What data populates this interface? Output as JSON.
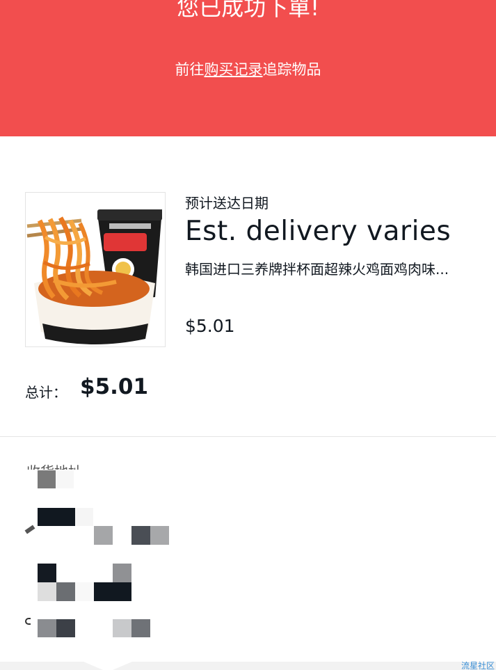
{
  "banner": {
    "title": "您已成功下單!",
    "subtitle_prefix": "前往",
    "subtitle_link": "购买记录",
    "subtitle_suffix": "追踪物品",
    "color": "#f24e4e"
  },
  "item": {
    "delivery_label": "预计送达日期",
    "delivery_value": "Est. delivery varies",
    "title": "韩国进口三养牌拌杯面超辣火鸡面鸡肉味...",
    "price": "$5.01",
    "image_alt": "samyang-buldak-cup-noodle-image"
  },
  "summary": {
    "total_label": "总计：",
    "total_value": "$5.01"
  },
  "address": {
    "heading": "收货地址"
  },
  "watermark": "流星社区"
}
